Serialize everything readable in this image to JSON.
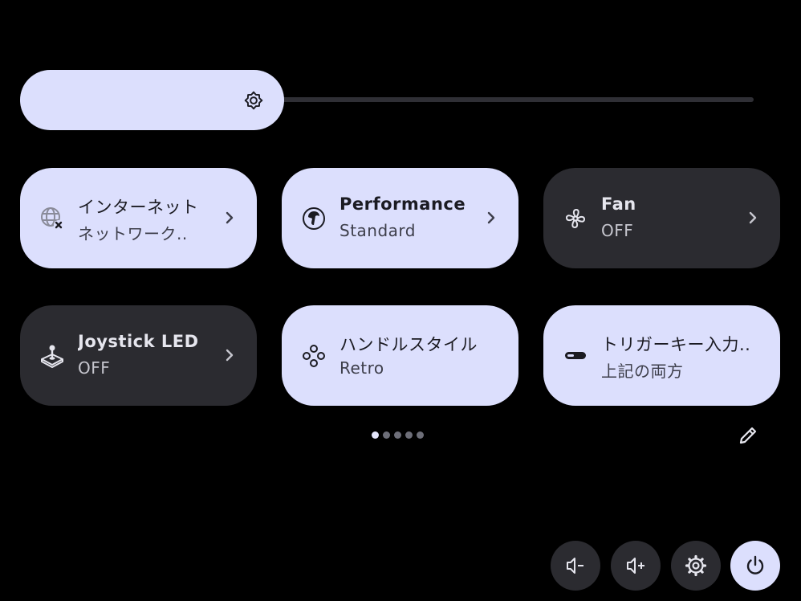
{
  "brightness": {
    "level": 0.36,
    "icon": "brightness-icon"
  },
  "tiles": [
    {
      "title": "インターネット",
      "subtitle": "ネットワーク..",
      "state": "on",
      "icon": "globe-off-icon",
      "chevron": true
    },
    {
      "title": "Performance",
      "subtitle": "Standard",
      "state": "on",
      "icon": "performance-icon",
      "chevron": true
    },
    {
      "title": "Fan",
      "subtitle": "OFF",
      "state": "off",
      "icon": "fan-icon",
      "chevron": true
    },
    {
      "title": "Joystick LED",
      "subtitle": "OFF",
      "state": "off",
      "icon": "joystick-icon",
      "chevron": true
    },
    {
      "title": "ハンドルスタイル",
      "subtitle": "Retro",
      "state": "on",
      "icon": "gamepad-buttons-icon",
      "chevron": false
    },
    {
      "title": "トリガーキー入力..",
      "subtitle": "上記の両方",
      "state": "on",
      "icon": "trigger-icon",
      "chevron": false
    }
  ],
  "pager": {
    "count": 5,
    "active": 1
  },
  "bottom_buttons": [
    {
      "name": "volume-down-button",
      "icon": "volume-down-icon"
    },
    {
      "name": "volume-up-button",
      "icon": "volume-up-icon"
    },
    {
      "name": "settings-button",
      "icon": "gear-icon"
    },
    {
      "name": "power-button",
      "icon": "power-icon"
    }
  ],
  "colors": {
    "accent": "#dcdffd",
    "tile_off": "#2b2b30",
    "background": "#000000"
  }
}
